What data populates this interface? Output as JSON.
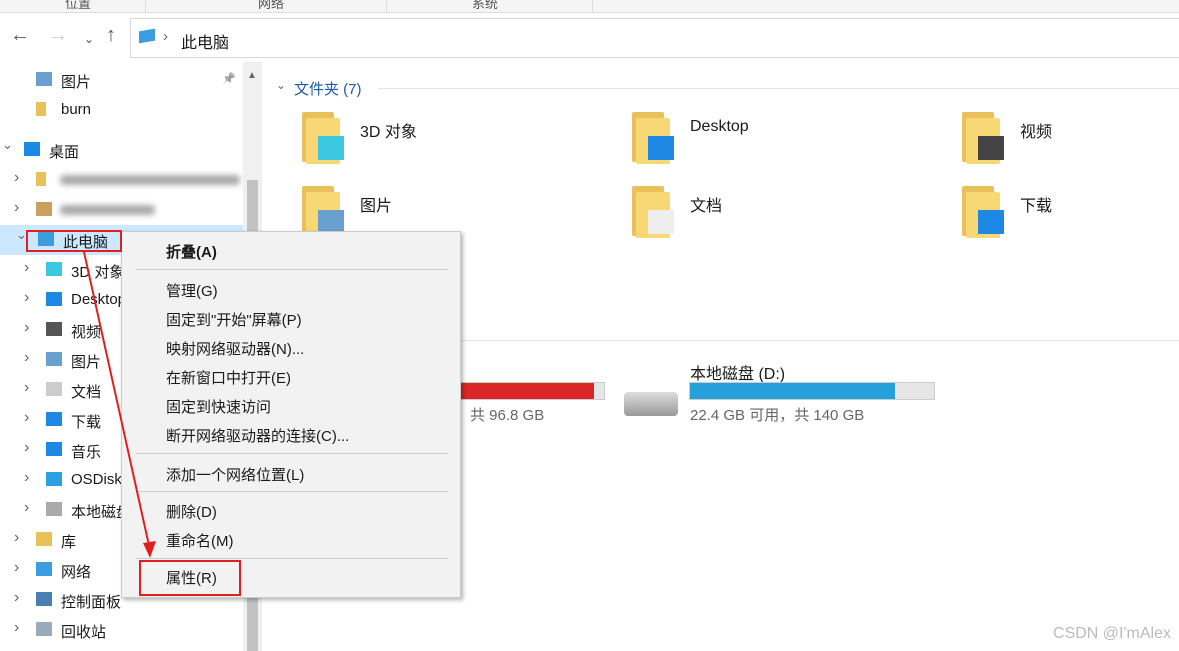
{
  "ribbon": {
    "groups": [
      "位置",
      "网络",
      "系统"
    ]
  },
  "address": {
    "path": "此电脑"
  },
  "sidebar": {
    "items": [
      {
        "label": "图片",
        "icon": "pictures-icon",
        "pinned": true
      },
      {
        "label": "burn",
        "icon": "folder-icon"
      },
      {
        "label": "桌面",
        "icon": "desktop-icon",
        "expanded": true
      },
      {
        "label": "",
        "icon": "folder-icon",
        "blurred": true
      },
      {
        "label": "",
        "icon": "user-icon",
        "blurred": true
      },
      {
        "label": "此电脑",
        "icon": "computer-icon",
        "expanded": true,
        "selected": true
      },
      {
        "label": "3D 对象",
        "icon": "3d-objects-icon"
      },
      {
        "label": "Desktop",
        "icon": "desktop-icon"
      },
      {
        "label": "视频",
        "icon": "videos-icon"
      },
      {
        "label": "图片",
        "icon": "pictures-icon"
      },
      {
        "label": "文档",
        "icon": "documents-icon"
      },
      {
        "label": "下载",
        "icon": "downloads-icon"
      },
      {
        "label": "音乐",
        "icon": "music-icon"
      },
      {
        "label": "OSDisk",
        "icon": "windows-drive-icon"
      },
      {
        "label": "本地磁盘",
        "icon": "drive-icon"
      },
      {
        "label": "库",
        "icon": "library-icon"
      },
      {
        "label": "网络",
        "icon": "network-icon"
      },
      {
        "label": "控制面板",
        "icon": "control-panel-icon"
      },
      {
        "label": "回收站",
        "icon": "recycle-bin-icon"
      }
    ]
  },
  "main": {
    "folders_header": "文件夹 (7)",
    "folders": [
      "3D 对象",
      "Desktop",
      "视频",
      "图片",
      "文档",
      "下载"
    ],
    "drives": [
      {
        "label": "",
        "space": "共 96.8 GB",
        "used_fraction": 0.93,
        "color": "#da2626"
      },
      {
        "label": "本地磁盘 (D:)",
        "space": "22.4 GB 可用，共 140 GB",
        "used_fraction": 0.84,
        "color": "#26a0da"
      }
    ]
  },
  "context_menu": {
    "items": [
      "折叠(A)",
      "管理(G)",
      "固定到\"开始\"屏幕(P)",
      "映射网络驱动器(N)...",
      "在新窗口中打开(E)",
      "固定到快速访问",
      "断开网络驱动器的连接(C)...",
      "添加一个网络位置(L)",
      "删除(D)",
      "重命名(M)",
      "属性(R)"
    ]
  },
  "watermark": "CSDN @I'mAlex"
}
